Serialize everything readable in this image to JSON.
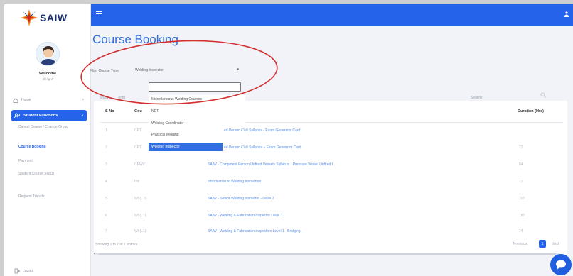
{
  "brand": {
    "logo_text": "SAIW"
  },
  "sidebar": {
    "welcome": "Welcome",
    "welcome_sub": "Delight",
    "home_label": "Home",
    "active_item": "Student Functions",
    "sub_items": [
      "Cancel Course / Change Group",
      "Course Booking",
      "Payment",
      "Student Course Status",
      "Request Transfer"
    ],
    "logout": "Logout"
  },
  "page": {
    "title": "Course Booking",
    "filter_label": "Filter Course Type",
    "filter_value": "Welding Inspector",
    "show_text": "Show",
    "show_text_2": "entri",
    "search_label": "Search:"
  },
  "dropdown": {
    "options": [
      "Miscellaneous Welding Courses",
      "NDT",
      "Welding Coordinator",
      "Practical Welding",
      "Welding Inspector"
    ],
    "selected_index": 4
  },
  "table": {
    "headers": {
      "sno": "S No",
      "code": "Cou",
      "duration": "Duration (Hrs)"
    },
    "rows": [
      {
        "sno": "1",
        "code": "CP1",
        "name": "…ed Person Civil Syllabus - Exam Generator Card",
        "duration": ""
      },
      {
        "sno": "2",
        "code": "CP1",
        "name": "…ed Person Civil Syllabus + Exam Generator Card",
        "duration": "72"
      },
      {
        "sno": "3",
        "code": "CPWV",
        "name": "SAIW - Competent Person Unfired Vessels Syllabus - Pressure Vessel Unfired I",
        "duration": "64"
      },
      {
        "sno": "4",
        "code": "IWI",
        "name": "Introduction to Welding Inspection",
        "duration": "72"
      },
      {
        "sno": "5",
        "code": "WI (L 2)",
        "name": "SAIW - Senior Welding Inspector - Level 2",
        "duration": "200"
      },
      {
        "sno": "6",
        "code": "WI (L1)",
        "name": "SAIW - Welding & Fabrication Inspector Level 1",
        "duration": "180"
      },
      {
        "sno": "7",
        "code": "WI (L1)",
        "name": "SAIW - Welding & Fabrication Inspection Level 1 - Bridging",
        "duration": "24"
      }
    ],
    "showing": "Showing 1 to 7 of 7 entries",
    "prev": "Previous",
    "page": "1",
    "next": "Next"
  },
  "colors": {
    "accent": "#2563eb",
    "annotation": "#d32f2f"
  }
}
